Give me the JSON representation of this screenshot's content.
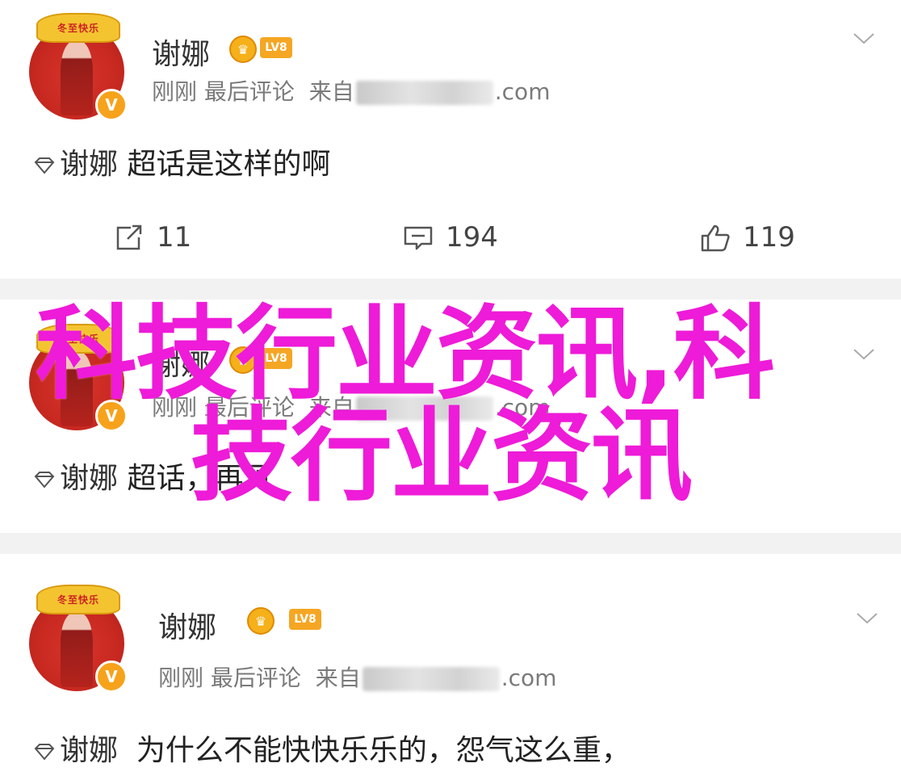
{
  "posts": [
    {
      "author": "谢娜",
      "level": "LV8",
      "time": "刚刚",
      "action_text": "最后评论",
      "source_prefix": "来自",
      "source_suffix": ".com",
      "topic": "谢娜",
      "text": "超话是这样的啊",
      "stats": {
        "share": "11",
        "comment": "194",
        "like": "119"
      }
    },
    {
      "author": "谢娜",
      "level": "LV8",
      "time": "刚刚",
      "action_text": "最后评论",
      "source_prefix": "来自",
      "source_suffix": ".com",
      "topic": "谢娜",
      "text": "超话，再见"
    },
    {
      "author": "谢娜",
      "level": "LV8",
      "time": "刚刚",
      "action_text": "最后评论",
      "source_prefix": "来自",
      "source_suffix": ".com",
      "topic": "谢娜",
      "text": "为什么不能快快乐乐的，怨气这么重，"
    }
  ],
  "avatar_text": "冬至快乐",
  "verified_mark": "V",
  "overlay": {
    "line1": "科技行业资讯,科",
    "line2": "技行业资讯",
    "color": "#ee1bd8"
  },
  "icons": {
    "topic": "diamond-icon",
    "share": "share-icon",
    "comment": "comment-icon",
    "like": "thumbs-up-icon",
    "menu": "chevron-down-icon"
  }
}
